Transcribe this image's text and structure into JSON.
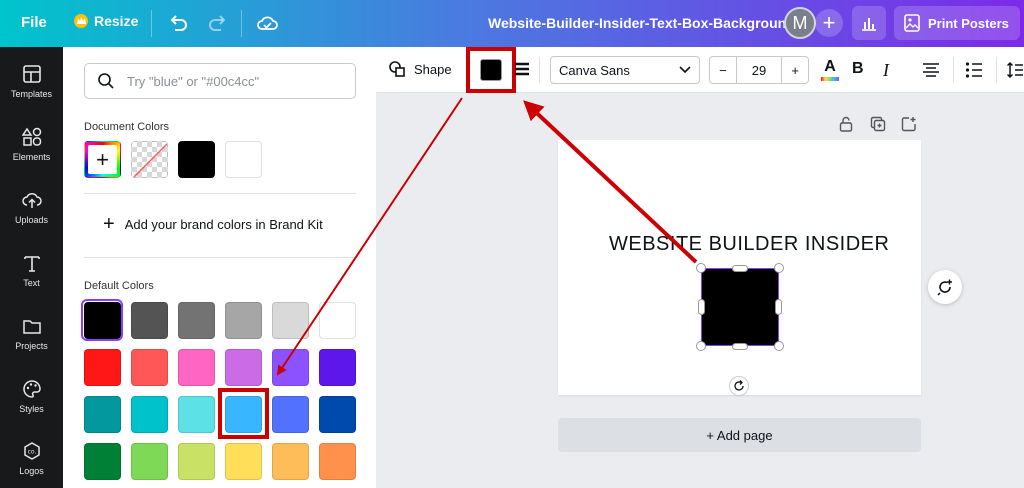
{
  "topbar": {
    "file_label": "File",
    "resize_label": "Resize",
    "document_title": "Website-Builder-Insider-Text-Box-Background",
    "avatar_initial": "M",
    "print_label": "Print Posters"
  },
  "rail": {
    "items": [
      {
        "label": "Templates",
        "icon": "templates-icon"
      },
      {
        "label": "Elements",
        "icon": "elements-icon"
      },
      {
        "label": "Uploads",
        "icon": "uploads-icon"
      },
      {
        "label": "Text",
        "icon": "text-icon"
      },
      {
        "label": "Projects",
        "icon": "projects-icon"
      },
      {
        "label": "Styles",
        "icon": "styles-icon"
      },
      {
        "label": "Logos",
        "icon": "logos-icon"
      }
    ]
  },
  "panel": {
    "search_placeholder": "Try \"blue\" or \"#00c4cc\"",
    "document_colors_label": "Document Colors",
    "document_colors": [
      "#000000",
      "#ffffff"
    ],
    "brand_kit_label": "Add your brand colors in Brand Kit",
    "default_colors_label": "Default Colors",
    "default_colors": [
      [
        "#000000",
        "#545454",
        "#737373",
        "#a6a6a6",
        "#d9d9d9",
        "#ffffff"
      ],
      [
        "#ff1616",
        "#ff5757",
        "#ff66c4",
        "#cb6ce6",
        "#8c52ff",
        "#5e17eb"
      ],
      [
        "#03989e",
        "#00c2cb",
        "#5ce1e6",
        "#38b6ff",
        "#5271ff",
        "#004aad"
      ],
      [
        "#008037",
        "#7ed957",
        "#c9e265",
        "#ffde59",
        "#ffbd59",
        "#ff914d"
      ]
    ],
    "selected_color": "#000000",
    "highlighted_color": "#38b6ff"
  },
  "toolbar": {
    "shape_label": "Shape",
    "current_fill": "#000000",
    "font_name": "Canva Sans",
    "font_size": "29",
    "minus": "−",
    "plus": "+",
    "bold": "B",
    "italic": "I"
  },
  "canvas": {
    "page_text": "WEBSITE BUILDER INSIDER",
    "shape_fill": "#000000",
    "add_page_label": "+ Add page"
  },
  "annotation": {
    "color": "#cc0000"
  }
}
